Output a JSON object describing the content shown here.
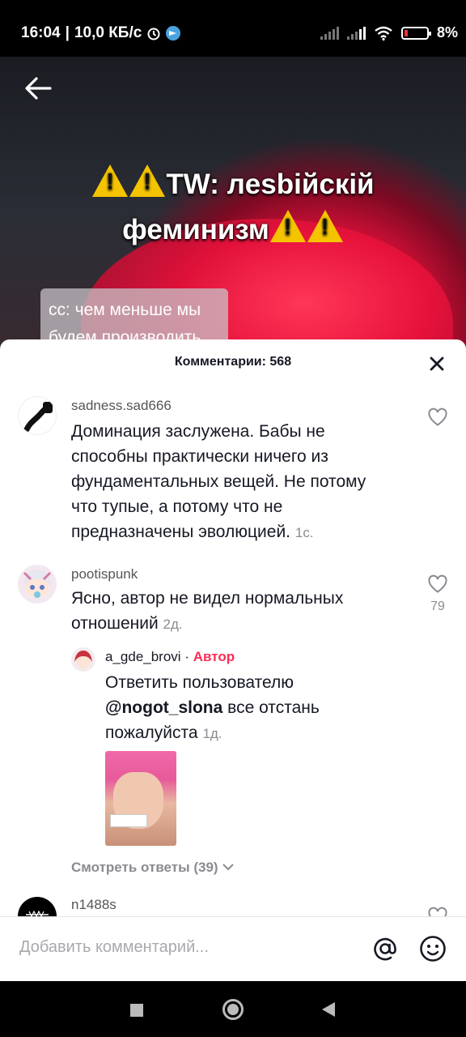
{
  "status_bar": {
    "time": "16:04",
    "speed": "10,0 КБ/с",
    "battery": "8%"
  },
  "video": {
    "title_line1": "TW: лesbiйскiй",
    "title_line2": "феминизм",
    "caption": "сс: чем меньше мы будем производить"
  },
  "comments_sheet": {
    "title": "Комментарии: 568",
    "comments": [
      {
        "username": "sadness.sad666",
        "text": "Доминация заслужена. Бабы не способны практически ничего из фундаментальных вещей. Не потому что тупые, а потому что не предназначены эволюцией.",
        "time": "1с."
      },
      {
        "username": "pootispunk",
        "text": "Ясно, автор не видел нормальных отношений",
        "time": "2д.",
        "likes": "79"
      }
    ],
    "reply": {
      "username": "a_gde_brovi",
      "separator": "·",
      "author_label": "Автор",
      "text_prefix": "Ответить пользователю",
      "mention": "@nogot_slona",
      "text_suffix": "все отстань пожалуйста",
      "time": "1д."
    },
    "view_replies": "Смотреть ответы (39)",
    "next_username": "n1488s",
    "input_placeholder": "Добавить комментарий..."
  },
  "colors": {
    "accent": "#fe2c55",
    "text": "#161823",
    "muted": "#8a8b91"
  }
}
